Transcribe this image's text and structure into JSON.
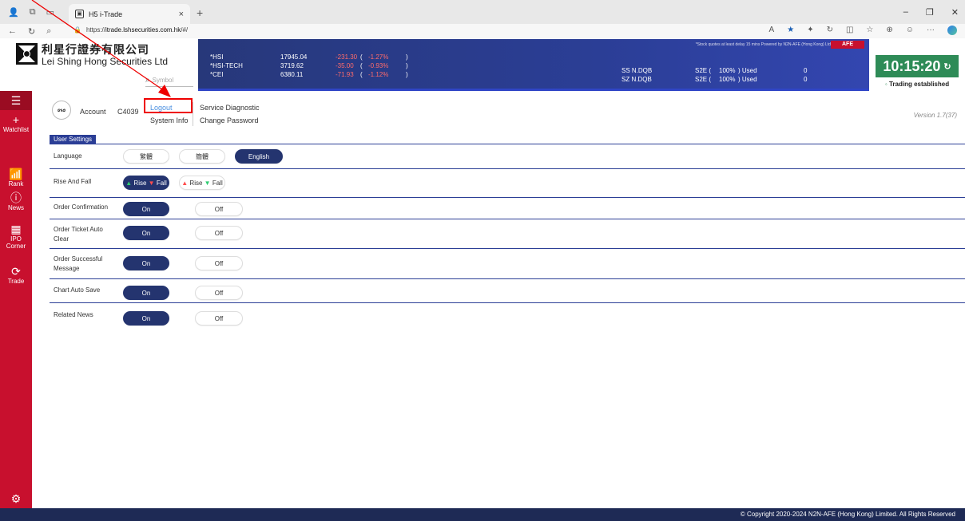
{
  "browser": {
    "tab_title": "H5 i-Trade",
    "url_prefix": "https://",
    "url_host": "itrade.lshsecurities.com.hk",
    "url_path": "/#/"
  },
  "header": {
    "brand_cn": "利星行證券有限公司",
    "brand_en": "Lei Shing Hong Securities Ltd",
    "symbol_placeholder": "Symbol",
    "indices": [
      {
        "name": "*HSI",
        "value": "17945.04",
        "change": "-231.30",
        "paren_open": "(",
        "pct": "-1.27%",
        "paren_close": ")"
      },
      {
        "name": "*HSI-TECH",
        "value": "3719.62",
        "change": "-35.00",
        "paren_open": "(",
        "pct": "-0.93%",
        "paren_close": ")"
      },
      {
        "name": "*CEI",
        "value": "6380.11",
        "change": "-71.93",
        "paren_open": "(",
        "pct": "-1.12%",
        "paren_close": ")"
      }
    ],
    "delay_note": "*Stock quotes at least delay 15 mins   Powered by N2N-AFE (Hong Kong) Ltd",
    "afe_logo": "AFE",
    "connections": [
      {
        "name": "SS N.DQB",
        "s2e": "S2E (",
        "pct": "100%",
        "used": ") Used",
        "count": "0"
      },
      {
        "name": "SZ N.DQB",
        "s2e": "S2E (",
        "pct": "100%",
        "used": ") Used",
        "count": "0"
      }
    ],
    "clock": "10:15:20",
    "trading_status": "Trading established"
  },
  "sidebar": {
    "items": [
      {
        "label": "",
        "glyph": "☰"
      },
      {
        "label": "Watchlist",
        "glyph": "+"
      },
      {
        "label": "Rank",
        "glyph": "📶"
      },
      {
        "label": "News",
        "glyph": "ⓘ"
      },
      {
        "label": "IPO Corner",
        "glyph": "▦"
      },
      {
        "label": "Trade",
        "glyph": "⟳"
      }
    ]
  },
  "account": {
    "label": "Account",
    "id": "C4039",
    "menu": {
      "logout": "Logout",
      "system_info": "System Info",
      "service_diagnostic": "Service Diagnostic",
      "change_password": "Change Password"
    },
    "version": "Version 1.7(37)"
  },
  "settings": {
    "tab_label": "User Settings",
    "language": {
      "label": "Language",
      "options": [
        "繁體",
        "簡體",
        "English"
      ],
      "selected": "English"
    },
    "rise_fall": {
      "label": "Rise And Fall",
      "opt1_rise": "Rise",
      "opt1_fall": "Fall",
      "opt2_rise": "Rise",
      "opt2_fall": "Fall"
    },
    "order_confirmation": {
      "label": "Order Confirmation",
      "on": "On",
      "off": "Off"
    },
    "order_ticket_auto_clear": {
      "label": "Order Ticket Auto Clear",
      "on": "On",
      "off": "Off"
    },
    "order_successful_message": {
      "label": "Order Successful Message",
      "on": "On",
      "off": "Off"
    },
    "chart_auto_save": {
      "label": "Chart Auto Save",
      "on": "On",
      "off": "Off"
    },
    "related_news": {
      "label": "Related News",
      "on": "On",
      "off": "Off"
    }
  },
  "footer": {
    "copyright": "© Copyright 2020-2024 N2N-AFE (Hong Kong) Limited. All Rights Reserved"
  },
  "colors": {
    "brand_red": "#c8102e",
    "header_blue": "#2b3e96",
    "pill_on": "#24346f",
    "clock_green": "#2e8b57",
    "annotation_red": "#e00000"
  }
}
